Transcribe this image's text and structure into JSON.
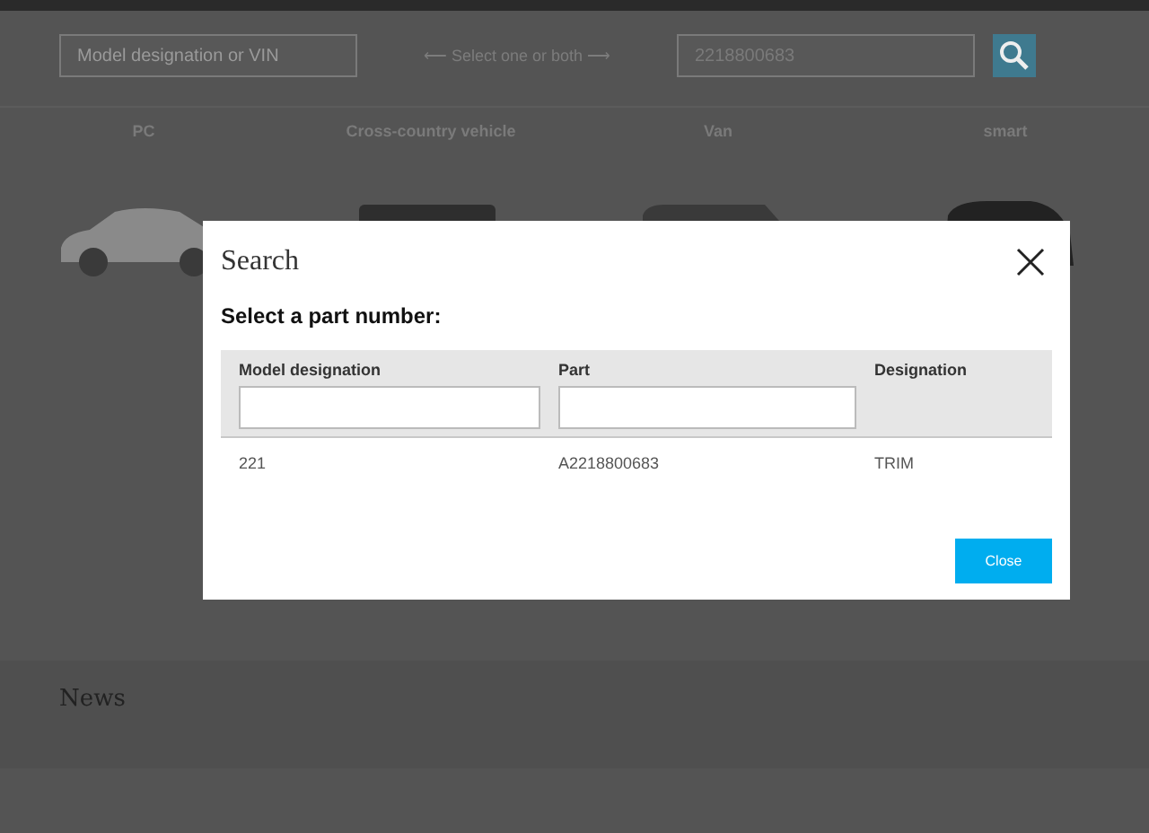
{
  "search": {
    "model_placeholder": "Model designation or VIN",
    "hint": "⟵ Select one or both ⟶",
    "part_value": "2218800683"
  },
  "categories": [
    {
      "label": "PC",
      "kind": "suv"
    },
    {
      "label": "Cross-country vehicle",
      "kind": "offroad"
    },
    {
      "label": "Van",
      "kind": "van"
    },
    {
      "label": "smart",
      "kind": "city"
    }
  ],
  "news": {
    "title": "News"
  },
  "dialog": {
    "title": "Search",
    "subtitle": "Select a part number:",
    "columns": [
      {
        "label": "Model designation",
        "filter": true
      },
      {
        "label": "Part",
        "filter": true
      },
      {
        "label": "Designation",
        "filter": false
      }
    ],
    "rows": [
      [
        "221",
        "A2218800683",
        "TRIM"
      ]
    ],
    "close_button": "Close"
  }
}
